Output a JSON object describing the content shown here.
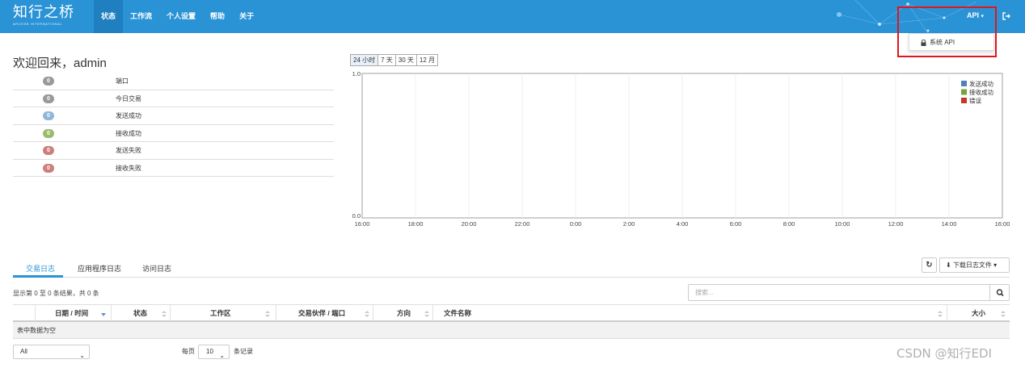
{
  "brand": {
    "name_cn": "知行之桥",
    "name_en": "ARCESB INTERNATIONAL"
  },
  "nav": {
    "items": [
      "状态",
      "工作流",
      "个人设置",
      "帮助",
      "关于"
    ],
    "active_index": 0
  },
  "api_menu": {
    "label": "API",
    "dropdown_item": "系统 API"
  },
  "welcome": "欢迎回来，admin",
  "stats": [
    {
      "count": "0",
      "label": "端口",
      "color": "#999999"
    },
    {
      "count": "0",
      "label": "今日交易",
      "color": "#999999"
    },
    {
      "count": "0",
      "label": "发送成功",
      "color": "#8fb7d9"
    },
    {
      "count": "0",
      "label": "接收成功",
      "color": "#9dbb6c"
    },
    {
      "count": "0",
      "label": "发送失败",
      "color": "#cf7f7b"
    },
    {
      "count": "0",
      "label": "接收失败",
      "color": "#cf7f7b"
    }
  ],
  "ranges": [
    "24 小时",
    "7 天",
    "30 天",
    "12 月"
  ],
  "chart_data": {
    "type": "line",
    "x": [
      "16:00",
      "18:00",
      "20:00",
      "22:00",
      "0:00",
      "2:00",
      "4:00",
      "6:00",
      "8:00",
      "10:00",
      "12:00",
      "14:00",
      "16:00"
    ],
    "y_ticks": [
      "0.0",
      "1.0"
    ],
    "ylim": [
      0,
      1
    ],
    "grid": true,
    "legend_position": "top-right",
    "series": [
      {
        "name": "发送成功",
        "color": "#4f81bd",
        "values": []
      },
      {
        "name": "接收成功",
        "color": "#76a33d",
        "values": []
      },
      {
        "name": "错误",
        "color": "#c0392b",
        "values": []
      }
    ]
  },
  "tabs": [
    "交易日志",
    "应用程序日志",
    "访问日志"
  ],
  "download_label": "下载日志文件",
  "info_text": "显示第 0 至 0 条结果，共 0 条",
  "search_placeholder": "搜索...",
  "table": {
    "columns": [
      "日期 / 时间",
      "状态",
      "工作区",
      "交易伙伴 / 端口",
      "方向",
      "文件名称",
      "大小"
    ],
    "empty_text": "表中数据为空"
  },
  "pagination": {
    "filter_value": "All",
    "per_page_prefix": "每页",
    "per_page_value": "10",
    "per_page_suffix": "条记录"
  },
  "watermark": "CSDN @知行EDI"
}
